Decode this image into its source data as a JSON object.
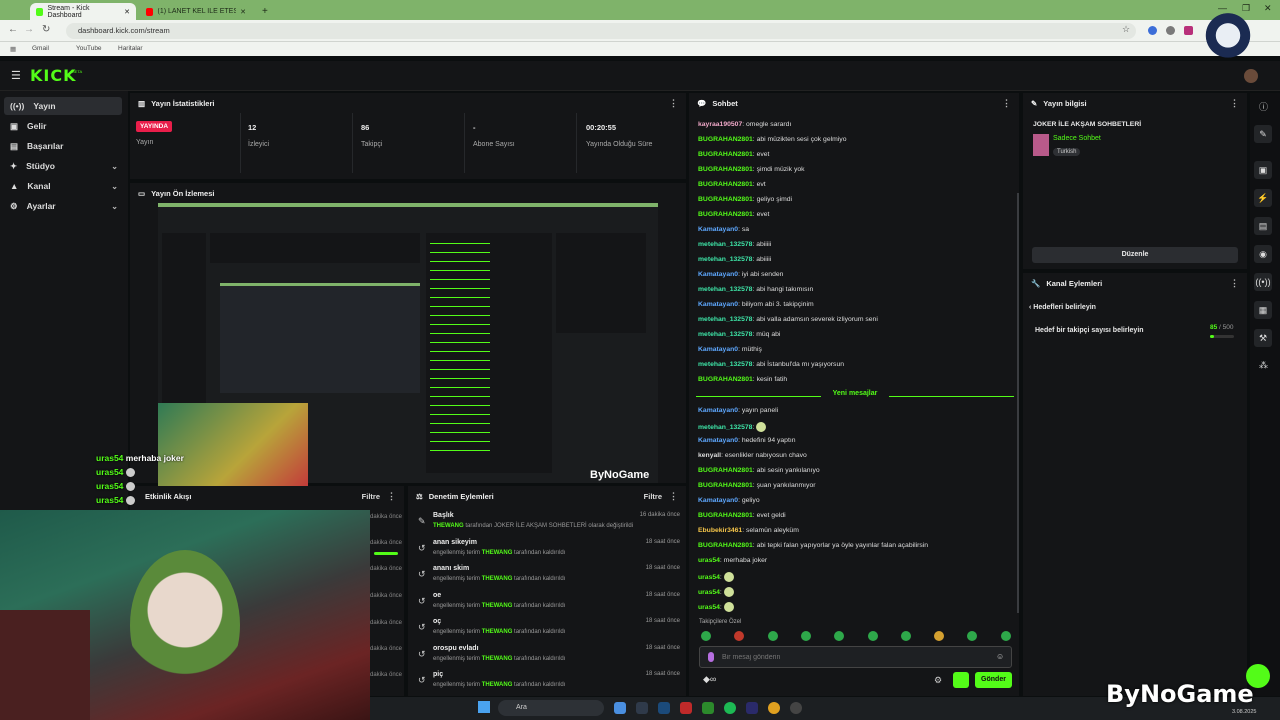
{
  "browser": {
    "tabs": [
      {
        "title": "Stream - Kick Dashboard",
        "active": true
      },
      {
        "title": "(1) LANET KEL İLE ETESTZ...",
        "active": false
      }
    ],
    "new_tab": "+",
    "url": "dashboard.kick.com/stream",
    "bookmarks": [
      "Gmail",
      "YouTube",
      "Haritalar"
    ],
    "window_buttons": [
      "—",
      "❐",
      "✕"
    ]
  },
  "kick": {
    "logo": "KICK",
    "logo_badge": "BETA",
    "sidebar": [
      {
        "label": "Yayın",
        "icon": "broadcast-icon",
        "active": true,
        "expandable": false
      },
      {
        "label": "Gelir",
        "icon": "wallet-icon",
        "active": false,
        "expandable": false
      },
      {
        "label": "Başarılar",
        "icon": "trophy-icon",
        "active": false,
        "expandable": false
      },
      {
        "label": "Stüdyo",
        "icon": "studio-icon",
        "active": false,
        "expandable": true
      },
      {
        "label": "Kanal",
        "icon": "channel-icon",
        "active": false,
        "expandable": true
      },
      {
        "label": "Ayarlar",
        "icon": "gear-icon",
        "active": false,
        "expandable": true
      }
    ],
    "stats": {
      "title": "Yayın İstatistikleri",
      "status_badge": "YAYINDA",
      "items": [
        {
          "value": "",
          "label": "Yayın"
        },
        {
          "value": "12",
          "label": "İzleyici"
        },
        {
          "value": "86",
          "label": "Takipçi"
        },
        {
          "value": "-",
          "label": "Abone Sayısı"
        },
        {
          "value": "00:20:55",
          "label": "Yayında Olduğu Süre"
        }
      ]
    },
    "preview": {
      "title": "Yayın Ön İzlemesi",
      "watermark": "ByNoGame"
    },
    "activity": {
      "title": "Etkinlik Akışı",
      "filter": "Filtre",
      "times": [
        "dakika önce",
        "dakika önce",
        "dakika önce",
        "dakika önce",
        "dakika önce",
        "dakika önce",
        "dakika önce"
      ]
    },
    "moderation": {
      "title": "Denetim Eylemleri",
      "filter": "Filtre",
      "items": [
        {
          "title": "Başlık",
          "by": "THEWANG",
          "pre": "",
          "post": "tarafından JOKER İLE AKŞAM SOHBETLERİ olarak değiştirildi",
          "time": "16 dakika önce"
        },
        {
          "title": "anan sikeyim",
          "pre": "engellenmiş terim",
          "by": "THEWANG",
          "post": "tarafından kaldırıldı",
          "time": "18 saat önce"
        },
        {
          "title": "ananı skim",
          "pre": "engellenmiş terim",
          "by": "THEWANG",
          "post": "tarafından kaldırıldı",
          "time": "18 saat önce"
        },
        {
          "title": "oe",
          "pre": "engellenmiş terim",
          "by": "THEWANG",
          "post": "tarafından kaldırıldı",
          "time": "18 saat önce"
        },
        {
          "title": "oç",
          "pre": "engellenmiş terim",
          "by": "THEWANG",
          "post": "tarafından kaldırıldı",
          "time": "18 saat önce"
        },
        {
          "title": "orospu evladı",
          "pre": "engellenmiş terim",
          "by": "THEWANG",
          "post": "tarafından kaldırıldı",
          "time": "18 saat önce"
        },
        {
          "title": "piç",
          "pre": "engellenmiş terim",
          "by": "THEWANG",
          "post": "tarafından kaldırıldı",
          "time": "18 saat önce"
        }
      ]
    },
    "chat": {
      "title": "Sohbet",
      "messages": [
        {
          "user": "kayraa190507",
          "color": "#f0a8c8",
          "text": "omegle sarardı"
        },
        {
          "user": "BUGRAHAN2801",
          "color": "#53fc18",
          "text": "abi müzikten sesi çok gelmiyo"
        },
        {
          "user": "BUGRAHAN2801",
          "color": "#53fc18",
          "text": "evet"
        },
        {
          "user": "BUGRAHAN2801",
          "color": "#53fc18",
          "text": "şimdi müzik yok"
        },
        {
          "user": "BUGRAHAN2801",
          "color": "#53fc18",
          "text": "evt"
        },
        {
          "user": "BUGRAHAN2801",
          "color": "#53fc18",
          "text": "geliyo şimdi"
        },
        {
          "user": "BUGRAHAN2801",
          "color": "#53fc18",
          "text": "evet"
        },
        {
          "user": "Kamatayan0",
          "color": "#5ea8ff",
          "text": "sa"
        },
        {
          "user": "metehan_132578",
          "color": "#3ee6a8",
          "text": "abiiiii"
        },
        {
          "user": "metehan_132578",
          "color": "#3ee6a8",
          "text": "abiiiii"
        },
        {
          "user": "Kamatayan0",
          "color": "#5ea8ff",
          "text": "iyi abi senden"
        },
        {
          "user": "metehan_132578",
          "color": "#3ee6a8",
          "text": "abi hangi takımısın"
        },
        {
          "user": "Kamatayan0",
          "color": "#5ea8ff",
          "text": "biliyom abi 3. takipçinim"
        },
        {
          "user": "metehan_132578",
          "color": "#3ee6a8",
          "text": "abi valla adamsın severek izliyorum seni"
        },
        {
          "user": "metehan_132578",
          "color": "#3ee6a8",
          "text": "müq abi"
        },
        {
          "user": "Kamatayan0",
          "color": "#5ea8ff",
          "text": "müthiş"
        },
        {
          "user": "metehan_132578",
          "color": "#3ee6a8",
          "text": "abi İstanbul'da mı yaşıyorsun"
        },
        {
          "user": "BUGRAHAN2801",
          "color": "#53fc18",
          "text": "kesin fatih"
        }
      ],
      "new_messages_label": "Yeni mesajlar",
      "new_messages": [
        {
          "user": "Kamatayan0",
          "color": "#5ea8ff",
          "text": "yayın paneli"
        },
        {
          "user": "metehan_132578",
          "color": "#3ee6a8",
          "text": ""
        },
        {
          "user": "Kamatayan0",
          "color": "#5ea8ff",
          "text": "hedefini 94 yaptın"
        },
        {
          "user": "kenyall",
          "color": "#dddddd",
          "text": "esenlikler nabıyosun chavo"
        },
        {
          "user": "BUGRAHAN2801",
          "color": "#53fc18",
          "text": "abi sesin yankılanıyo"
        },
        {
          "user": "BUGRAHAN2801",
          "color": "#53fc18",
          "text": "şuan yankılanmıyor"
        },
        {
          "user": "Kamatayan0",
          "color": "#5ea8ff",
          "text": "geliyo"
        },
        {
          "user": "BUGRAHAN2801",
          "color": "#53fc18",
          "text": "evet geldi"
        },
        {
          "user": "Ebubekir3461",
          "color": "#f6c64a",
          "text": "selamün aleyküm"
        },
        {
          "user": "BUGRAHAN2801",
          "color": "#53fc18",
          "text": "abi tepki falan yapıyorlar ya öyle yayınlar falan açabilirsin"
        },
        {
          "user": "uras54",
          "color": "#53fc18",
          "text": "merhaba joker"
        },
        {
          "user": "uras54",
          "color": "#53fc18",
          "text": ""
        },
        {
          "user": "uras54",
          "color": "#53fc18",
          "text": ""
        },
        {
          "user": "uras54",
          "color": "#53fc18",
          "text": ""
        }
      ],
      "emote_label": "Takipçilere Özel",
      "input_placeholder": "Bir mesaj gönderin",
      "points": "∞",
      "send": "Gönder"
    },
    "stream_info": {
      "title": "Yayın bilgisi",
      "stream_title": "JOKER İLE AKŞAM SOHBETLERİ",
      "category": "Sadece Sohbet",
      "tag": "Turkish",
      "edit": "Düzenle"
    },
    "channel_actions": {
      "title": "Kanal Eylemleri",
      "back_label": "Hedefleri belirleyin",
      "goal_label": "Hedef bir takipçi sayısı belirleyin",
      "goal_current": "85",
      "goal_total": "/ 500",
      "goal_progress": 0.17
    }
  },
  "overlay": {
    "chat": [
      {
        "user": "uras54",
        "text": "merhaba joker"
      },
      {
        "user": "uras54",
        "text": ""
      },
      {
        "user": "uras54",
        "text": ""
      },
      {
        "user": "uras54",
        "text": ""
      }
    ],
    "watermark": "ByNoGame"
  },
  "taskbar": {
    "search": "Ara",
    "clock_date": "3.08.2025"
  },
  "colors": {
    "accent": "#53fc18",
    "live": "#e91e4a",
    "panel": "#141517",
    "background": "#0b0e0f"
  }
}
